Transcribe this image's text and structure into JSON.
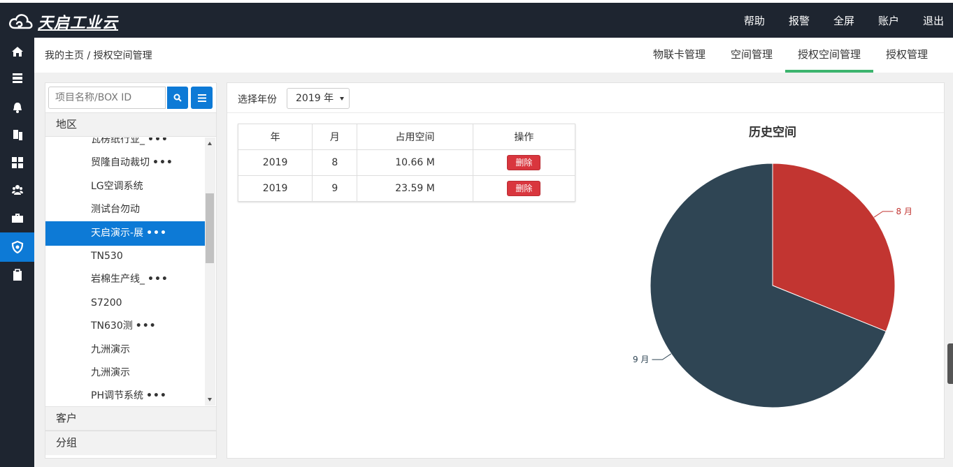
{
  "app": {
    "logo_text": "天启工业云",
    "top_nav": [
      "帮助",
      "报警",
      "全屏",
      "账户",
      "退出"
    ]
  },
  "sidebar_icons": [
    {
      "name": "home-icon",
      "active": false
    },
    {
      "name": "server-icon",
      "active": false
    },
    {
      "name": "bell-icon",
      "active": false
    },
    {
      "name": "copy-icon",
      "active": false
    },
    {
      "name": "grid-icon",
      "active": false
    },
    {
      "name": "users-icon",
      "active": false
    },
    {
      "name": "briefcase-icon",
      "active": false
    },
    {
      "name": "shield-icon",
      "active": true
    },
    {
      "name": "clipboard-icon",
      "active": false
    }
  ],
  "header": {
    "breadcrumb": "我的主页 / 授权空间管理",
    "tabs": [
      {
        "label": "物联卡管理",
        "active": false
      },
      {
        "label": "空间管理",
        "active": false
      },
      {
        "label": "授权空间管理",
        "active": true
      },
      {
        "label": "授权管理",
        "active": false
      }
    ]
  },
  "tree": {
    "search_placeholder": "项目名称/BOX ID",
    "sections": [
      "地区",
      "客户",
      "分组"
    ],
    "items": [
      {
        "label": "瓦楞纸行业_",
        "more": true
      },
      {
        "label": "贸隆自动裁切",
        "more": true
      },
      {
        "label": "LG空调系统",
        "more": false
      },
      {
        "label": "测试台勿动",
        "more": false
      },
      {
        "label": "天启演示-展",
        "more": true,
        "active": true
      },
      {
        "label": "TN530",
        "more": false
      },
      {
        "label": "岩棉生产线_",
        "more": true
      },
      {
        "label": "S7200",
        "more": false
      },
      {
        "label": "TN630测",
        "more": true
      },
      {
        "label": "九洲演示",
        "more": false
      },
      {
        "label": "九洲演示",
        "more": false
      },
      {
        "label": "PH调节系统",
        "more": true
      }
    ]
  },
  "main": {
    "year_label": "选择年份",
    "year_value": "2019 年",
    "table": {
      "headers": [
        "年",
        "月",
        "占用空间",
        "操作"
      ],
      "rows": [
        {
          "year": "2019",
          "month": "8",
          "space": "10.66 M",
          "action": "删除"
        },
        {
          "year": "2019",
          "month": "9",
          "space": "23.59 M",
          "action": "删除"
        }
      ]
    }
  },
  "chart_data": {
    "type": "pie",
    "title": "历史空间",
    "categories": [
      "8 月",
      "9 月"
    ],
    "values": [
      10.66,
      23.59
    ],
    "colors": [
      "#c23531",
      "#2f4554"
    ]
  }
}
